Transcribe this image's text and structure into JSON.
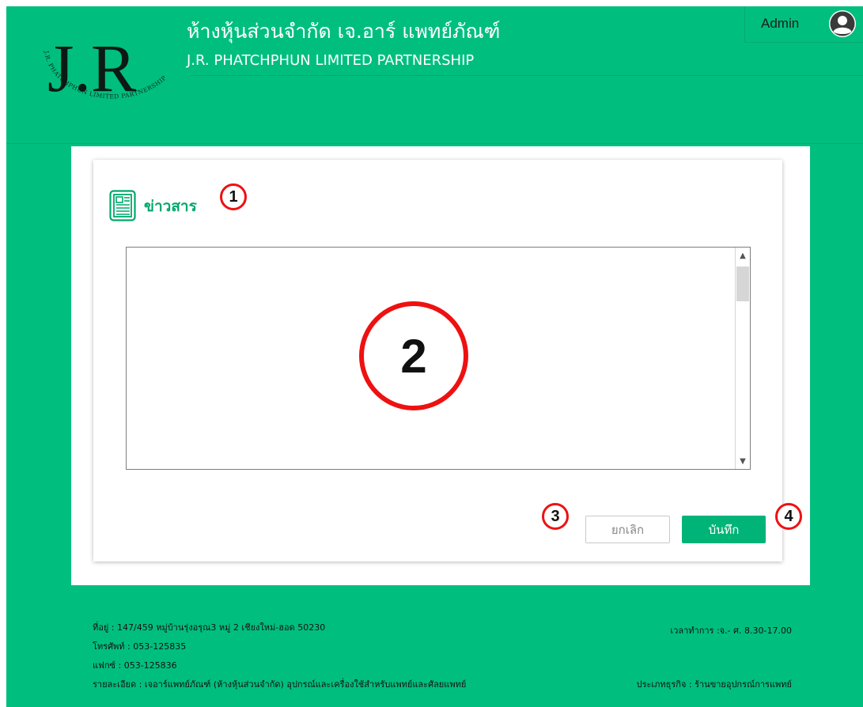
{
  "header": {
    "logo_text": "J.R",
    "logo_ring_text": "J.R. PHATCHPHUN LIMITED PARTNERSHIP",
    "company_name_th": "ห้างหุ้นส่วนจำกัด เจ.อาร์ แพทย์ภัณฑ์",
    "company_name_en": "J.R. PHATCHPHUN LIMITED PARTNERSHIP",
    "user_label": "Admin",
    "avatar_icon": "user-avatar-icon"
  },
  "news": {
    "icon": "newspaper-icon",
    "title": "ข่าวสาร",
    "textarea_value": "",
    "cancel_label": "ยกเลิก",
    "save_label": "บันทึก"
  },
  "markers": {
    "m1": "1",
    "m2": "2",
    "m3": "3",
    "m4": "4"
  },
  "footer": {
    "address": "ที่อยู่ : 147/459 หมู่บ้านรุ่งอรุณ3 หมู่ 2 เชียงใหม่-ฮอด 50230",
    "phone": "โทรศัพท์ : 053-125835",
    "fax": "แฟกซ์ : 053-125836",
    "details": "รายละเอียด : เจอาร์แพทย์ภัณฑ์ (ห้างหุ้นส่วนจำกัด) อุปกรณ์และเครื่องใช้สำหรับแพทย์และศัลยแพทย์",
    "hours": "เวลาทำการ :จ.- ศ. 8.30-17.00",
    "business_type": "ประเภทธุรกิจ : ร้านขายอุปกรณ์การแพทย์"
  },
  "colors": {
    "brand_green": "#00bf7e",
    "title_green": "#00a86b",
    "save_button": "#00b478",
    "marker_red": "#ee1111"
  }
}
